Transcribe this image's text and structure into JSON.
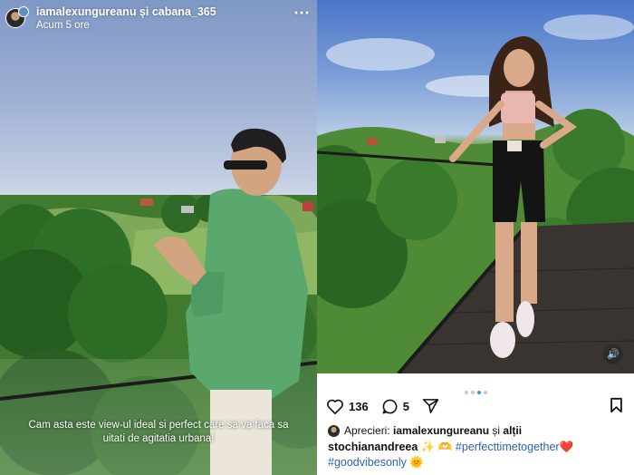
{
  "story": {
    "username": "iamalexungureanu și cabana_365",
    "time": "Acum 5 ore",
    "more_icon": "⋯",
    "caption": "Cam asta este view-ul ideal si perfect care sa va faca sa uitati de agitatia urbana!"
  },
  "post": {
    "sound_icon": "🔊",
    "likes_count": "136",
    "comments_count": "5",
    "liked_by_label": "Aprecieri:",
    "liked_by_user": "iamalexungureanu",
    "liked_by_suffix": "și",
    "liked_by_others": "alții",
    "caption_user": "stochianandreea",
    "caption_emojis": "✨ 🫶",
    "hashtag_1": "#perfecttimetogether",
    "heart_emoji": "❤️",
    "hashtag_2": "#goodvibesonly",
    "sun_emoji": "🌞",
    "carousel_total": 4,
    "carousel_active": 3
  },
  "colors": {
    "link": "#2f5fb3",
    "dot_active": "#3897f0",
    "dot_inactive": "#c8c8c8"
  }
}
